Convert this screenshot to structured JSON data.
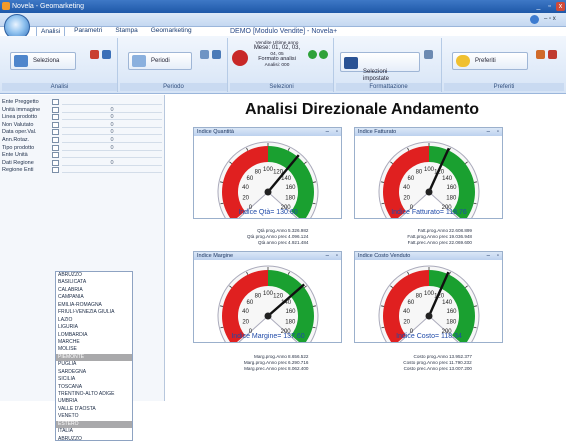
{
  "window": {
    "title": "Novela - Geomarketing",
    "document_title": "DEMO [Modulo Vendite] - Novela+",
    "controls": [
      "_",
      "▫",
      "x"
    ]
  },
  "tabs": [
    {
      "label": "Analisi",
      "active": true
    },
    {
      "label": "Parametri",
      "active": false
    },
    {
      "label": "Stampa",
      "active": false
    },
    {
      "label": "Geomarketing",
      "active": false
    }
  ],
  "ribbon": {
    "groups": [
      {
        "label": "Analisi"
      },
      {
        "label": "Periodo"
      },
      {
        "label": "Selezioni"
      },
      {
        "label": "Formattazione"
      },
      {
        "label": "Preferiti"
      }
    ],
    "analysis_button": "Seleziona",
    "period_button": "Periodi",
    "period_info": [
      "Vendite Ultime anno",
      "Mese: 01, 02, 03,",
      "04, 05",
      "Formato analisi",
      "Analisi: 000"
    ],
    "selection_button": "Selezioni\nimpostate",
    "favorites_button": "Preferiti"
  },
  "sidebar": {
    "rows": [
      {
        "label": "Ente Preggetto",
        "value": ""
      },
      {
        "label": "Unità immagine",
        "value": "0"
      },
      {
        "label": "Linea prodotto",
        "value": "0"
      },
      {
        "label": "Non Valutato",
        "value": "0"
      },
      {
        "label": "Data oper.Val.",
        "value": "0"
      },
      {
        "label": "Ann.Rotaz.",
        "value": "0"
      },
      {
        "label": "Tipo prodotto",
        "value": "0"
      },
      {
        "label": "Ente Unità",
        "value": ""
      },
      {
        "label": "Dati Regione",
        "value": "0"
      },
      {
        "label": "Regione Enti",
        "value": ""
      }
    ],
    "regions": [
      "ABRUZZO",
      "BASILICATA",
      "CALABRIA",
      "CAMPANIA",
      "EMILIA-ROMAGNA",
      "FRIULI-VENEZIA GIULIA",
      "LAZIO",
      "LIGURIA",
      "LOMBARDIA",
      "MARCHE",
      "MOLISE",
      "PIEMONTE",
      "PUGLIA",
      "SARDEGNA",
      "SICILIA",
      "TOSCANA",
      "TRENTINO-ALTO ADIGE",
      "UMBRIA",
      "VALLE D'AOSTA",
      "VENETO",
      "ESTERO",
      "ITALIA",
      "ABRUZZO"
    ],
    "selected_index": 11
  },
  "main_title": "Analisi Direzionale Andamento",
  "gauges": [
    {
      "header": "Indice Quantità",
      "caption": "Indice Qtà= 130.60",
      "value": 130.6,
      "range": [
        0,
        200
      ],
      "ticks": [
        0,
        20,
        40,
        60,
        80,
        100,
        120,
        140,
        160,
        180,
        200
      ],
      "stats": [
        {
          "k": "Qtà prog.Anno",
          "v": "5.326.982"
        },
        {
          "k": "Qtà prog.Anno prec",
          "v": "4.096.124"
        },
        {
          "k": "Qtà anno prec",
          "v": "4.921.484"
        }
      ]
    },
    {
      "header": "Indice Fatturato",
      "caption": "Indice Fatturato= 118.76",
      "value": 118.76,
      "range": [
        0,
        200
      ],
      "ticks": [
        0,
        20,
        40,
        60,
        80,
        100,
        120,
        140,
        160,
        180,
        200
      ],
      "stats": [
        {
          "k": "Fatt.prog.Anno",
          "v": "22.608.899"
        },
        {
          "k": "Fatt.prog.Anno prec",
          "v": "19.036.948"
        },
        {
          "k": "Fatt.prec.Anno prec",
          "v": "22.069.600"
        }
      ]
    },
    {
      "header": "Indice Margine",
      "caption": "Indice Margine= 137.60",
      "value": 137.6,
      "range": [
        0,
        200
      ],
      "ticks": [
        0,
        20,
        40,
        60,
        80,
        100,
        120,
        140,
        160,
        180,
        200
      ],
      "stats": [
        {
          "k": "Marg.prog.Anno",
          "v": "8.656.522"
        },
        {
          "k": "Marg.prog.Anno prec",
          "v": "6.290.716"
        },
        {
          "k": "Marg.prec.Anno prec",
          "v": "8.062.400"
        }
      ]
    },
    {
      "header": "Indice Costo Venduto",
      "caption": "Indice Costo= 118.34",
      "value": 118.34,
      "range": [
        0,
        200
      ],
      "ticks": [
        0,
        20,
        40,
        60,
        80,
        100,
        120,
        140,
        160,
        180,
        200
      ],
      "stats": [
        {
          "k": "Costo prog.Anno",
          "v": "13.952.377"
        },
        {
          "k": "Costo prog.Anno prec",
          "v": "11.790.232"
        },
        {
          "k": "Costo prec.Anno prec",
          "v": "13.007.200"
        }
      ]
    }
  ],
  "colors": {
    "red": "#e02020",
    "green": "#1aa030",
    "titlebar": "#2a62b0",
    "ribbon": "#dce8f7"
  }
}
